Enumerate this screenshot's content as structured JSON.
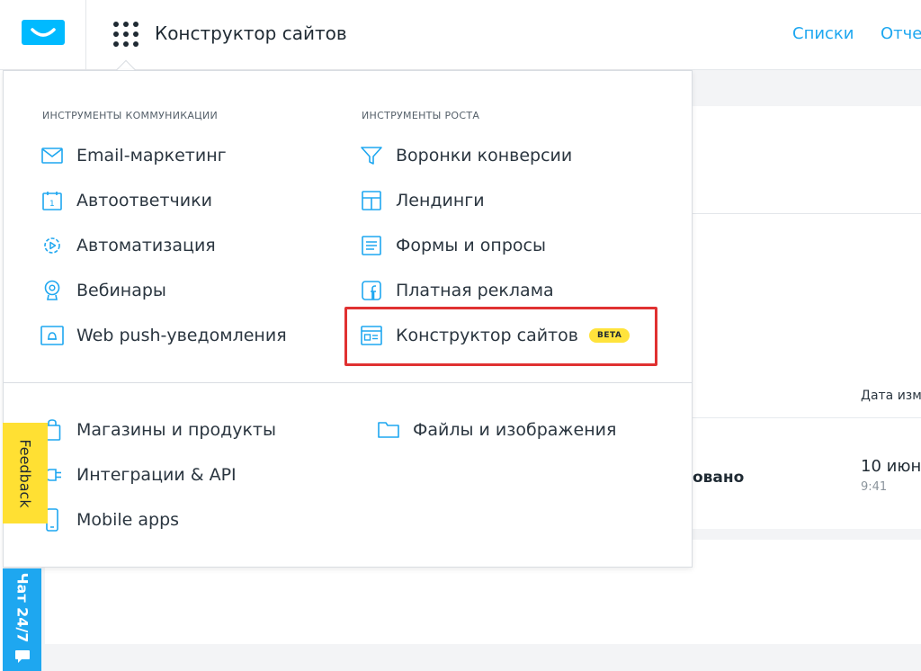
{
  "topbar": {
    "title": "Конструктор сайтов",
    "nav": [
      "Списки",
      "Отче"
    ]
  },
  "menu": {
    "communication_heading": "ИНСТРУМЕНТЫ КОММУНИКАЦИИ",
    "growth_heading": "ИНСТРУМЕНТЫ РОСТА",
    "communication_items": [
      {
        "label": "Email-маркетинг",
        "icon": "envelope-icon"
      },
      {
        "label": "Автоответчики",
        "icon": "calendar-icon"
      },
      {
        "label": "Автоматизация",
        "icon": "automation-gear-icon"
      },
      {
        "label": "Вебинары",
        "icon": "webcam-icon"
      },
      {
        "label": "Web push-уведомления",
        "icon": "bell-window-icon"
      }
    ],
    "growth_items": [
      {
        "label": "Воронки конверсии",
        "icon": "funnel-icon"
      },
      {
        "label": "Лендинги",
        "icon": "landing-layout-icon"
      },
      {
        "label": "Формы и опросы",
        "icon": "form-icon"
      },
      {
        "label": "Платная реклама",
        "icon": "facebook-ad-icon"
      },
      {
        "label": "Конструктор сайтов",
        "icon": "website-builder-icon",
        "badge": "BETA"
      }
    ],
    "bottom_left_items": [
      {
        "label": "Магазины и продукты",
        "icon": "shopping-bag-icon"
      },
      {
        "label": "Интеграции & API",
        "icon": "plug-icon"
      },
      {
        "label": "Mobile apps",
        "icon": "mobile-phone-icon"
      }
    ],
    "bottom_right_items": [
      {
        "label": "Файлы и изображения",
        "icon": "folder-icon"
      }
    ]
  },
  "background": {
    "column_header": "Дата изм",
    "status": "овано",
    "date": "10 июн",
    "time": "9:41"
  },
  "side_tabs": {
    "feedback": "Feedback",
    "chat": "Чат 24/7"
  },
  "colors": {
    "accent": "#1ea7f0",
    "badge": "#ffe33c",
    "highlight": "#e03131",
    "feedback": "#ffe033"
  }
}
